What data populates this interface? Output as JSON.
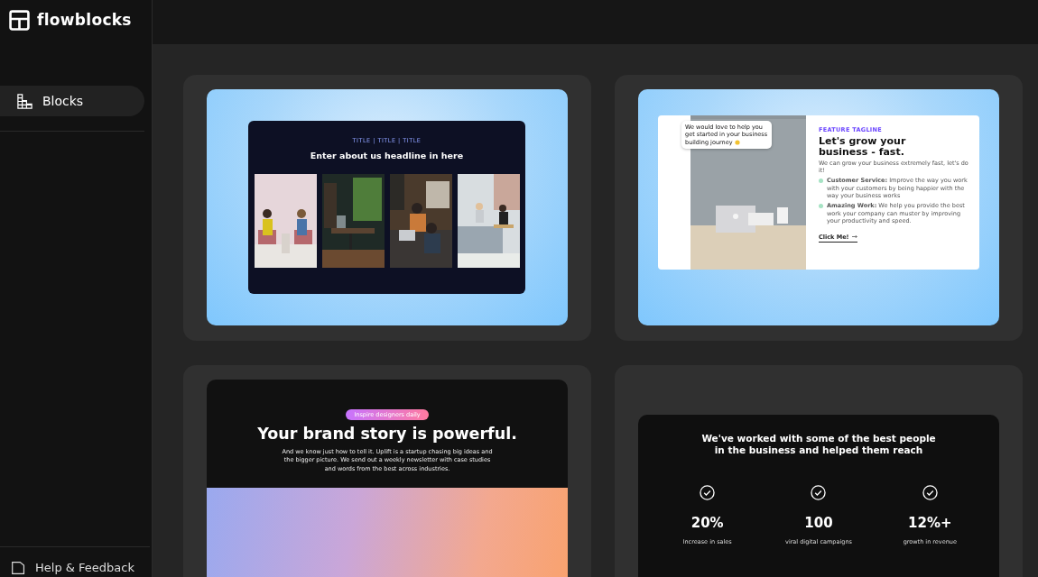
{
  "brand": {
    "name": "flowblocks"
  },
  "sidebar": {
    "items": [
      {
        "label": "Blocks",
        "selected": true
      }
    ],
    "footer": {
      "label": "Help & Feedback"
    }
  },
  "blocks": [
    {
      "kind": "about",
      "eyebrow": "TITLE | TITLE | TITLE",
      "headline": "Enter about us headline in here"
    },
    {
      "kind": "feature",
      "bubble": "We would love to help you get started in your business building journey",
      "tagline": "FEATURE TAGLINE",
      "headline": "Let's grow your business - fast.",
      "intro": "We can grow your business extremely fast, let's do it!",
      "points": [
        "**Customer Service:** Improve the way you work with your customers by being happier with the way your business works",
        "**Amazing Work:** We help you provide the best work your company can muster by improving your productivity and speed."
      ],
      "cta": "Click Me!"
    },
    {
      "kind": "story",
      "pill": "Inspire designers daily",
      "headline": "Your brand story is powerful.",
      "text": "And we know just how to tell it. Uplift is a startup chasing big ideas and the bigger picture. We send out a weekly newsletter with case studies and words from the best across industries."
    },
    {
      "kind": "stats",
      "headline": "We've worked with some of the best people in the business and helped them reach",
      "stats": [
        {
          "value": "20%",
          "label": "Increase in sales"
        },
        {
          "value": "100",
          "label": "viral digital campaigns"
        },
        {
          "value": "12%+",
          "label": "growth in revenue"
        }
      ]
    }
  ]
}
